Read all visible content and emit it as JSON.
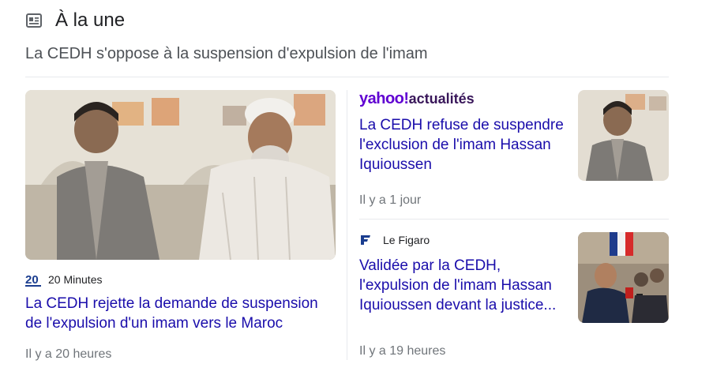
{
  "section": {
    "title": "À la une",
    "subtitle": "La CEDH s'oppose à la suspension d'expulsion de l'imam"
  },
  "articles": [
    {
      "source": "20 Minutes",
      "headline": "La CEDH rejette la demande de suspension de l'expulsion d'un imam vers le Maroc",
      "time": "Il y a 20 heures"
    },
    {
      "source_logo_text": "yahoo!",
      "source_logo_suffix": "actualités",
      "headline": "La CEDH refuse de suspendre l'exclusion de l'imam Hassan Iquioussen",
      "time": "Il y a 1 jour"
    },
    {
      "source": "Le Figaro",
      "headline": "Validée par la CEDH, l'expulsion de l'imam Hassan Iquioussen devant la justice...",
      "time": "Il y a 19 heures"
    }
  ],
  "colors": {
    "link": "#1a0dab",
    "meta": "#70757a",
    "yahoo": "#6001d2"
  },
  "icons": [
    "news-icon",
    "20-minutes-logo",
    "yahoo-logo",
    "le-figaro-logo"
  ]
}
